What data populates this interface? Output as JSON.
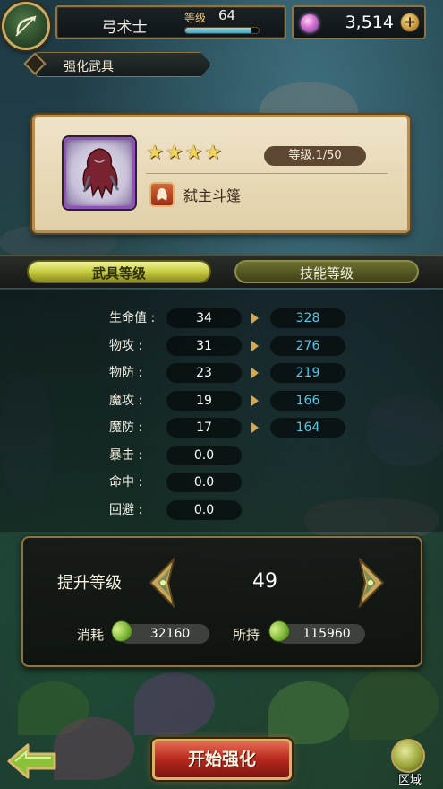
{
  "header": {
    "class_name": "弓术士",
    "level_label": "等级",
    "level_value": "64",
    "xp_progress": 0.9,
    "currency_value": "3,514",
    "currency_icon": "gem-icon",
    "add_label": "+"
  },
  "section": {
    "title": "强化武具"
  },
  "weapon": {
    "stars": [
      "★",
      "★",
      "★",
      "★"
    ],
    "level_text": "等级.1/50",
    "name": "弑主斗篷",
    "rarity_color": "#8f52b5"
  },
  "tabs": [
    {
      "label": "武具等级",
      "active": true
    },
    {
      "label": "技能等级",
      "active": false
    }
  ],
  "stats": [
    {
      "label": "生命值 :",
      "current": "34",
      "next": "328"
    },
    {
      "label": "物攻 :",
      "current": "31",
      "next": "276"
    },
    {
      "label": "物防 :",
      "current": "23",
      "next": "219"
    },
    {
      "label": "魔攻 :",
      "current": "19",
      "next": "166"
    },
    {
      "label": "魔防 :",
      "current": "17",
      "next": "164"
    },
    {
      "label": "暴击 :",
      "current": "0.0",
      "next": null
    },
    {
      "label": "命中 :",
      "current": "0.0",
      "next": null
    },
    {
      "label": "回避 :",
      "current": "0.0",
      "next": null
    }
  ],
  "upgrade": {
    "label": "提升等级",
    "target_level": "49",
    "cost_label": "消耗",
    "cost_value": "32160",
    "owned_label": "所持",
    "owned_value": "115960"
  },
  "bottom": {
    "start_label": "开始强化",
    "region_label": "区域"
  },
  "colors": {
    "accent_gold": "#c9ab6a",
    "next_value": "#4fc8ea",
    "active_tab": "#c7cc3f",
    "start_button": "#b7291c"
  }
}
